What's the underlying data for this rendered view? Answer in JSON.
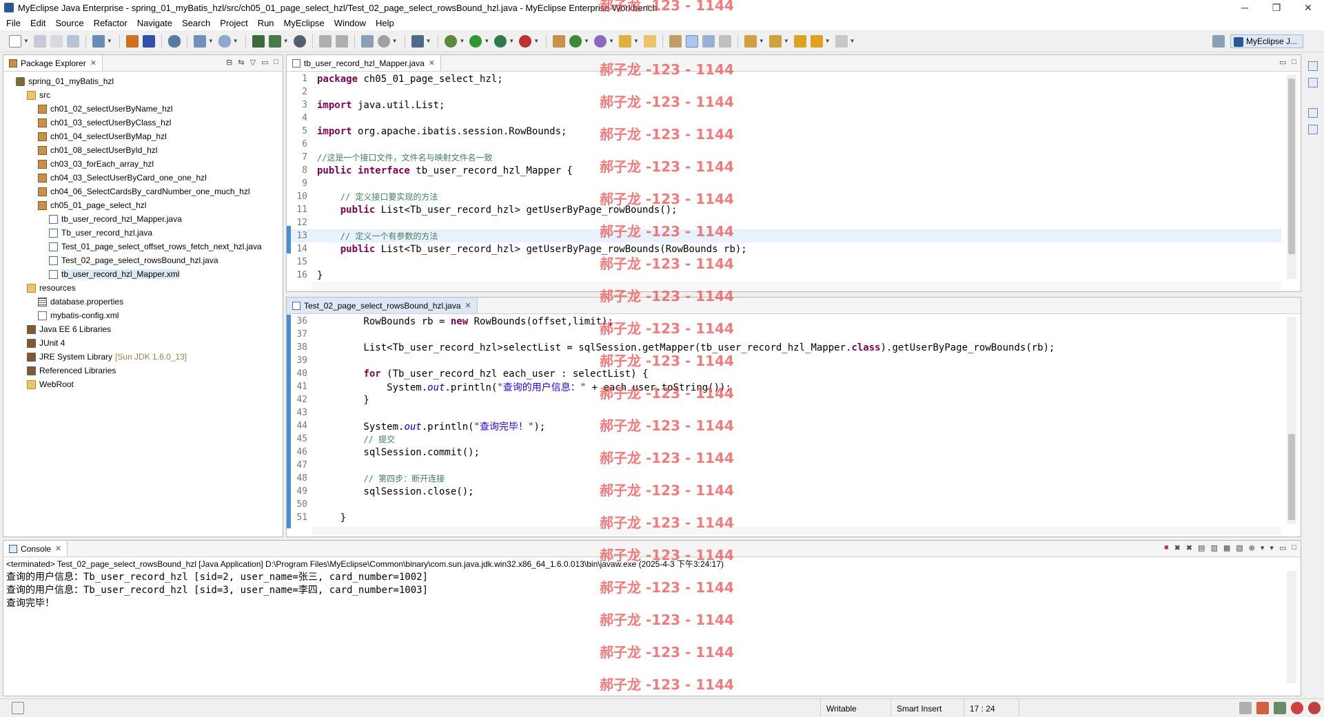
{
  "window": {
    "title": "MyEclipse Java Enterprise - spring_01_myBatis_hzl/src/ch05_01_page_select_hzl/Test_02_page_select_rowsBound_hzl.java - MyEclipse Enterprise Workbench",
    "minimize": "─",
    "maximize": "❐",
    "close": "✕"
  },
  "menu": [
    "File",
    "Edit",
    "Source",
    "Refactor",
    "Navigate",
    "Search",
    "Project",
    "Run",
    "MyEclipse",
    "Window",
    "Help"
  ],
  "perspective": {
    "label": "MyEclipse J..."
  },
  "package_explorer": {
    "tab": "Package Explorer",
    "items": [
      {
        "label": "spring_01_myBatis_hzl",
        "icon": "project-icon"
      },
      {
        "label": "src",
        "icon": "source-folder-icon"
      },
      {
        "label": "ch01_02_selectUserByName_hzl",
        "icon": "package-icon"
      },
      {
        "label": "ch01_03_selectUserByClass_hzl",
        "icon": "package-icon"
      },
      {
        "label": "ch01_04_selectUserByMap_hzl",
        "icon": "package-icon"
      },
      {
        "label": "ch01_08_selectUserById_hzl",
        "icon": "package-icon"
      },
      {
        "label": "ch03_03_forEach_array_hzl",
        "icon": "package-icon"
      },
      {
        "label": "ch04_03_SelectUserByCard_one_one_hzl",
        "icon": "package-icon"
      },
      {
        "label": "ch04_06_SelectCardsBy_cardNumber_one_much_hzl",
        "icon": "package-icon"
      },
      {
        "label": "ch05_01_page_select_hzl",
        "icon": "package-icon"
      },
      {
        "label": "tb_user_record_hzl_Mapper.java",
        "icon": "java-file-icon"
      },
      {
        "label": "Tb_user_record_hzl.java",
        "icon": "java-file-icon"
      },
      {
        "label": "Test_01_page_select_offset_rows_fetch_next_hzl.java",
        "icon": "java-file-icon"
      },
      {
        "label": "Test_02_page_select_rowsBound_hzl.java",
        "icon": "java-file-icon"
      },
      {
        "label": "tb_user_record_hzl_Mapper.xml",
        "icon": "xml-file-icon"
      },
      {
        "label": "resources",
        "icon": "source-folder-icon"
      },
      {
        "label": "database.properties",
        "icon": "properties-file-icon"
      },
      {
        "label": "mybatis-config.xml",
        "icon": "xml-file-icon"
      },
      {
        "label": "Java EE 6 Libraries",
        "icon": "library-icon"
      },
      {
        "label": "JUnit 4",
        "icon": "library-icon"
      },
      {
        "label": "JRE System Library",
        "suffix": "[Sun JDK 1.6.0_13]",
        "icon": "library-icon"
      },
      {
        "label": "Referenced Libraries",
        "icon": "library-icon"
      },
      {
        "label": "WebRoot",
        "icon": "folder-icon"
      }
    ]
  },
  "editor_mapper": {
    "tab": "tb_user_record_hzl_Mapper.java",
    "lines": [
      {
        "n": "1",
        "kw": "package",
        "rest": " ch05_01_page_select_hzl;"
      },
      {
        "n": "2",
        "kw": "",
        "rest": ""
      },
      {
        "n": "3",
        "kw": "import",
        "rest": " java.util.List;"
      },
      {
        "n": "4",
        "kw": "",
        "rest": ""
      },
      {
        "n": "5",
        "kw": "import",
        "rest": " org.apache.ibatis.session.RowBounds;"
      },
      {
        "n": "6",
        "kw": "",
        "rest": ""
      },
      {
        "n": "7",
        "comment": "//这是一个接口文件，文件名与映射文件名一致"
      },
      {
        "n": "8",
        "kw": "public interface",
        "rest": " tb_user_record_hzl_Mapper {"
      },
      {
        "n": "9",
        "kw": "",
        "rest": ""
      },
      {
        "n": "10",
        "indent": "    ",
        "comment": "// 定义接口要实现的方法"
      },
      {
        "n": "11",
        "indent": "    ",
        "kw": "public",
        "rest": " List<Tb_user_record_hzl> getUserByPage_rowBounds();"
      },
      {
        "n": "12",
        "kw": "",
        "rest": ""
      },
      {
        "n": "13",
        "indent": "    ",
        "comment": "// 定义一个有参数的方法"
      },
      {
        "n": "14",
        "indent": "    ",
        "kw": "public",
        "rest": " List<Tb_user_record_hzl> getUserByPage_rowBounds(RowBounds rb);"
      },
      {
        "n": "15",
        "kw": "",
        "rest": ""
      },
      {
        "n": "16",
        "kw": "",
        "rest": "}"
      }
    ]
  },
  "editor_test": {
    "tab": "Test_02_page_select_rowsBound_hzl.java",
    "lines": [
      {
        "n": "36",
        "html": "        RowBounds rb = <span class=\"kw\">new</span> RowBounds(offset,limit);"
      },
      {
        "n": "37",
        "html": ""
      },
      {
        "n": "38",
        "html": "        List&lt;Tb_user_record_hzl&gt;selectList = sqlSession.getMapper(tb_user_record_hzl_Mapper.<span class=\"kw\">class</span>).getUserByPage_rowBounds(rb);"
      },
      {
        "n": "39",
        "html": ""
      },
      {
        "n": "40",
        "html": "        <span class=\"kw\">for</span> (Tb_user_record_hzl each_user : selectList) {"
      },
      {
        "n": "41",
        "html": "            System.<span class=\"it\">out</span>.println(<span class=\"st\">\"查询的用户信息：\"</span> + each_user.toString());"
      },
      {
        "n": "42",
        "html": "        }"
      },
      {
        "n": "43",
        "html": ""
      },
      {
        "n": "44",
        "html": "        System.<span class=\"it\">out</span>.println(<span class=\"st\">\"查询完毕！\"</span>);"
      },
      {
        "n": "45",
        "html": "        <span class=\"cm\">// 提交</span>"
      },
      {
        "n": "46",
        "html": "        sqlSession.commit();"
      },
      {
        "n": "47",
        "html": ""
      },
      {
        "n": "48",
        "html": "        <span class=\"cm\">// 第四步：断开连接</span>"
      },
      {
        "n": "49",
        "html": "        sqlSession.close();"
      },
      {
        "n": "50",
        "html": ""
      },
      {
        "n": "51",
        "html": "    }"
      }
    ]
  },
  "console": {
    "tab": "Console",
    "launch": "<terminated> Test_02_page_select_rowsBound_hzl [Java Application] D:\\Program Files\\MyEclipse\\Common\\binary\\com.sun.java.jdk.win32.x86_64_1.6.0.013\\bin\\javaw.exe (2025-4-3 下午3:24:17)",
    "output": [
      "查询的用户信息：Tb_user_record_hzl [sid=2, user_name=张三, card_number=1002]",
      "查询的用户信息：Tb_user_record_hzl [sid=3, user_name=李四, card_number=1003]",
      "查询完毕！"
    ]
  },
  "statusbar": {
    "writable": "Writable",
    "insert_mode": "Smart Insert",
    "position": "17 : 24"
  },
  "watermark": "郝子龙 -123 - 1144"
}
